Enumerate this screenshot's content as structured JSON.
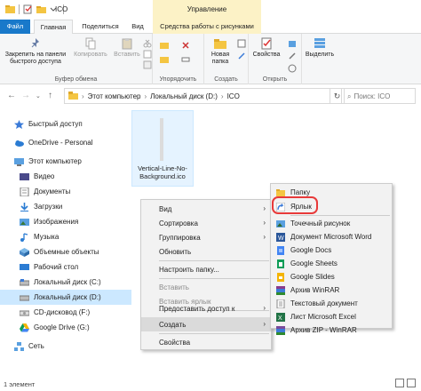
{
  "window": {
    "title": "ICO",
    "contextual_tab_group": "Управление"
  },
  "ribbon_tabs": [
    "Файл",
    "Главная",
    "Поделиться",
    "Вид",
    "Средства работы с рисунками"
  ],
  "ribbon": {
    "clipboard": {
      "pin_label": "Закрепить на панели быстрого доступа",
      "copy_label": "Копировать",
      "paste_label": "Вставить",
      "group_label": "Буфер обмена"
    },
    "organize": {
      "group_label": "Упорядочить"
    },
    "new": {
      "new_folder_label": "Новая папка",
      "group_label": "Создать"
    },
    "open": {
      "properties_label": "Свойства",
      "group_label": "Открыть"
    },
    "select": {
      "select_label": "Выделить"
    }
  },
  "address": {
    "path": [
      "Этот компьютер",
      "Локальный диск (D:)",
      "ICO"
    ],
    "search_placeholder": "Поиск: ICO"
  },
  "nav": {
    "items": [
      {
        "label": "Быстрый доступ",
        "icon": "star-icon"
      },
      {
        "label": "OneDrive - Personal",
        "icon": "cloud-icon"
      },
      {
        "label": "Этот компьютер",
        "icon": "computer-icon"
      },
      {
        "label": "Видео",
        "icon": "video-icon"
      },
      {
        "label": "Документы",
        "icon": "documents-icon"
      },
      {
        "label": "Загрузки",
        "icon": "downloads-icon"
      },
      {
        "label": "Изображения",
        "icon": "pictures-icon"
      },
      {
        "label": "Музыка",
        "icon": "music-icon"
      },
      {
        "label": "Объемные объекты",
        "icon": "3d-objects-icon"
      },
      {
        "label": "Рабочий стол",
        "icon": "desktop-icon"
      },
      {
        "label": "Локальный диск (C:)",
        "icon": "drive-icon"
      },
      {
        "label": "Локальный диск (D:)",
        "icon": "drive-icon"
      },
      {
        "label": "CD-дисковод (F:)",
        "icon": "cd-drive-icon"
      },
      {
        "label": "Google Drive (G:)",
        "icon": "google-drive-icon"
      },
      {
        "label": "Сеть",
        "icon": "network-icon"
      }
    ]
  },
  "file": {
    "name": "Vertical-Line-No-Background.ico"
  },
  "context_menu": {
    "items": [
      {
        "label": "Вид",
        "submenu": true,
        "disabled": false
      },
      {
        "label": "Сортировка",
        "submenu": true,
        "disabled": false
      },
      {
        "label": "Группировка",
        "submenu": true,
        "disabled": false
      },
      {
        "label": "Обновить",
        "submenu": false,
        "disabled": false
      },
      {
        "label": "Настроить папку...",
        "submenu": false,
        "disabled": false
      },
      {
        "label": "Вставить",
        "submenu": false,
        "disabled": true
      },
      {
        "label": "Вставить ярлык",
        "submenu": false,
        "disabled": true
      },
      {
        "label": "Предоставить доступ к",
        "submenu": true,
        "disabled": false
      },
      {
        "label": "Создать",
        "submenu": true,
        "disabled": false
      },
      {
        "label": "Свойства",
        "submenu": false,
        "disabled": false
      }
    ]
  },
  "submenu": {
    "items": [
      {
        "label": "Папку",
        "icon": "folder-icon",
        "color": "#f4c542"
      },
      {
        "label": "Ярлык",
        "icon": "shortcut-icon",
        "color": "#3b7bd8"
      },
      {
        "label": "Точечный рисунок",
        "icon": "bitmap-icon",
        "color": "#5aa0e0"
      },
      {
        "label": "Документ Microsoft Word",
        "icon": "word-icon",
        "color": "#2b579a"
      },
      {
        "label": "Google Docs",
        "icon": "google-docs-icon",
        "color": "#4285f4"
      },
      {
        "label": "Google Sheets",
        "icon": "google-sheets-icon",
        "color": "#0f9d58"
      },
      {
        "label": "Google Slides",
        "icon": "google-slides-icon",
        "color": "#f4b400"
      },
      {
        "label": "Архив WinRAR",
        "icon": "winrar-icon",
        "color": "#8b3a8b"
      },
      {
        "label": "Текстовый документ",
        "icon": "text-document-icon",
        "color": "#ffffff"
      },
      {
        "label": "Лист Microsoft Excel",
        "icon": "excel-icon",
        "color": "#217346"
      },
      {
        "label": "Архив ZIP - WinRAR",
        "icon": "zip-winrar-icon",
        "color": "#7a4a9a"
      }
    ]
  },
  "status": {
    "count": "1 элемент"
  }
}
